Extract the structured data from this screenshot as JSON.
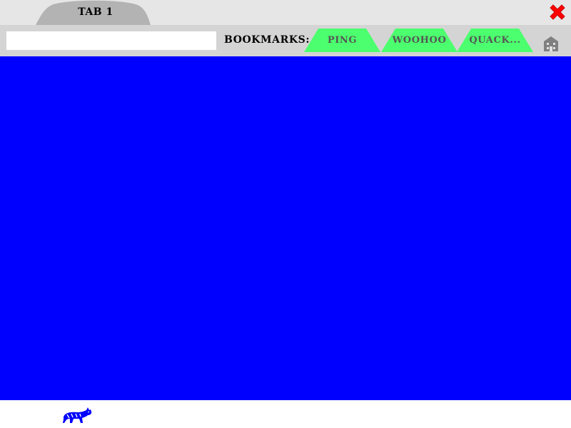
{
  "tabs": [
    {
      "label": "TAB 1",
      "active": true
    }
  ],
  "toolbar": {
    "url_value": "",
    "bookmarks_label": "BOOKMARKS:",
    "bookmarks": [
      {
        "label": "PING"
      },
      {
        "label": "WOOHOO"
      },
      {
        "label": "QUACK..."
      }
    ]
  },
  "icons": {
    "close": "close-icon",
    "home": "home-icon",
    "mascot": "animal-icon"
  },
  "colors": {
    "tab_strip": "#e6e6e6",
    "tab": "#b3b3b3",
    "toolbar": "#d4d4d4",
    "bookmark_fill": "#4cff6e",
    "close": "#ff0000",
    "content": "#0000ff",
    "mascot": "#0000ff"
  }
}
